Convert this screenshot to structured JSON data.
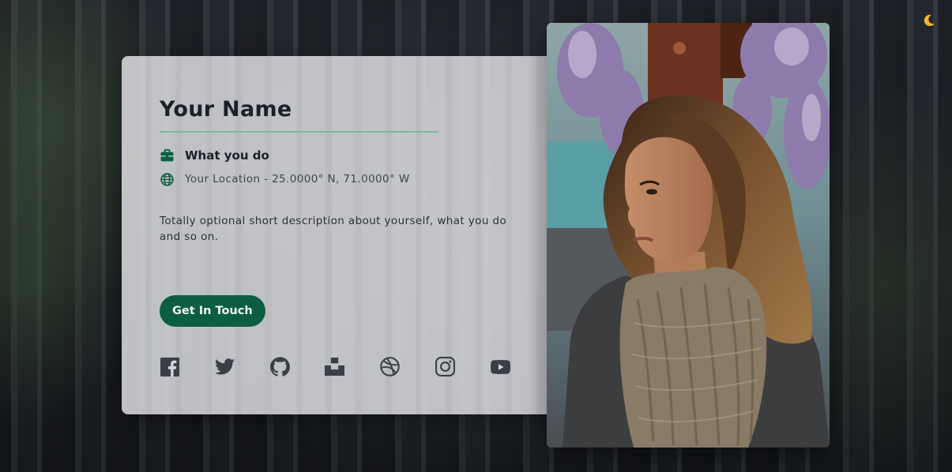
{
  "profile": {
    "name": "Your Name",
    "occupation": "What you do",
    "location": "Your Location - 25.0000° N, 71.0000° W",
    "description": "Totally optional short description about yourself, what you do and so on."
  },
  "actions": {
    "contact_label": "Get In Touch"
  },
  "socials": [
    {
      "icon": "facebook-icon"
    },
    {
      "icon": "twitter-icon"
    },
    {
      "icon": "github-icon"
    },
    {
      "icon": "unsplash-icon"
    },
    {
      "icon": "dribbble-icon"
    },
    {
      "icon": "instagram-icon"
    },
    {
      "icon": "youtube-icon"
    }
  ],
  "theme_toggle": {
    "icon": "moon-icon"
  },
  "colors": {
    "accent": "#0b5e41",
    "divider": "#7cb89a",
    "heading": "#1c2029",
    "icon": "#3a3f47"
  }
}
